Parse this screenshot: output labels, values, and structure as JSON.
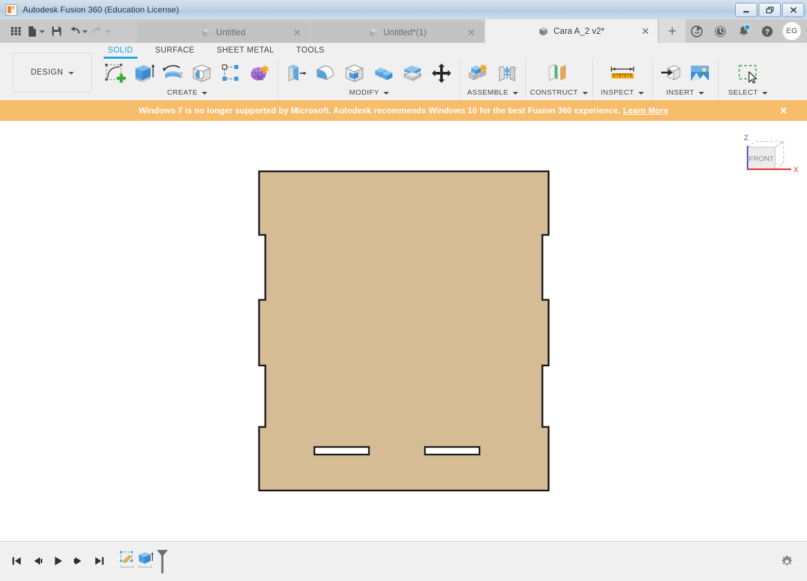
{
  "window": {
    "title": "Autodesk Fusion 360 (Education License)",
    "app_icon": "fusion360-logo-icon",
    "controls": {
      "minimize": "minimize-icon",
      "restore": "restore-icon",
      "close": "close-icon"
    }
  },
  "quick_access": [
    {
      "name": "apps-grid-icon",
      "label": "",
      "has_caret": false,
      "dim": false
    },
    {
      "name": "new-file-icon",
      "label": "",
      "has_caret": true,
      "dim": false
    },
    {
      "name": "save-icon",
      "label": "",
      "has_caret": false,
      "dim": false
    },
    {
      "name": "undo-icon",
      "label": "",
      "has_caret": true,
      "dim": false
    },
    {
      "name": "redo-icon",
      "label": "",
      "has_caret": true,
      "dim": true
    }
  ],
  "document_tabs": [
    {
      "label": "Untitled",
      "active": false
    },
    {
      "label": "Untitled*(1)",
      "active": false
    },
    {
      "label": "Cara A_2 v2*",
      "active": true
    }
  ],
  "new_tab_label": "+",
  "top_right_icons": [
    {
      "name": "job-status-icon",
      "badge": false
    },
    {
      "name": "recent-activity-clock-icon",
      "badge": false
    },
    {
      "name": "notifications-bell-icon",
      "badge": true
    },
    {
      "name": "help-icon",
      "badge": false
    }
  ],
  "account": {
    "initials": "EG"
  },
  "ribbon": {
    "design_label": "DESIGN",
    "workspace_tabs": [
      {
        "label": "SOLID",
        "active": true
      },
      {
        "label": "SURFACE",
        "active": false
      },
      {
        "label": "SHEET METAL",
        "active": false
      },
      {
        "label": "TOOLS",
        "active": false
      }
    ],
    "panels": [
      {
        "label": "CREATE",
        "has_caret": true,
        "buttons": [
          {
            "name": "create-sketch-icon"
          },
          {
            "name": "extrude-icon"
          },
          {
            "name": "revolve-icon"
          },
          {
            "name": "hole-icon"
          },
          {
            "name": "rectangular-pattern-icon"
          },
          {
            "name": "create-form-icon"
          }
        ]
      },
      {
        "label": "MODIFY",
        "has_caret": true,
        "buttons": [
          {
            "name": "press-pull-icon"
          },
          {
            "name": "fillet-icon"
          },
          {
            "name": "shell-icon"
          },
          {
            "name": "combine-icon"
          },
          {
            "name": "split-face-icon"
          },
          {
            "name": "move-copy-icon"
          }
        ]
      },
      {
        "label": "ASSEMBLE",
        "has_caret": true,
        "buttons": [
          {
            "name": "new-component-icon"
          },
          {
            "name": "joint-icon"
          }
        ]
      },
      {
        "label": "CONSTRUCT",
        "has_caret": true,
        "buttons": [
          {
            "name": "offset-plane-icon"
          }
        ]
      },
      {
        "label": "INSPECT",
        "has_caret": true,
        "buttons": [
          {
            "name": "measure-icon"
          }
        ]
      },
      {
        "label": "INSERT",
        "has_caret": true,
        "buttons": [
          {
            "name": "insert-derive-icon"
          },
          {
            "name": "insert-image-icon"
          }
        ]
      },
      {
        "label": "SELECT",
        "has_caret": true,
        "buttons": [
          {
            "name": "select-window-icon"
          }
        ]
      }
    ]
  },
  "banner": {
    "message": "Windows 7 is no longer supported by Microsoft. Autodesk recommends Windows 10 for the best Fusion 360 experience.",
    "link_label": "Learn More",
    "close_label": "✕",
    "background_color": "#f7bd6b",
    "text_color": "#ffffff"
  },
  "canvas": {
    "background_color": "#ffffff",
    "model": {
      "name": "notched-panel-body",
      "fill_color": "#d6bc94",
      "edge_color": "#1a1a1a",
      "slot_fill_color": "#ffffff",
      "slots": 2,
      "side_notches_per_side": 3
    },
    "viewcube": {
      "face_label": "FRONT",
      "axis_z_label": "Z",
      "axis_x_label": "X",
      "axis_z_color": "#5b57d6",
      "axis_x_color": "#e03434"
    }
  },
  "bottom_bar": {
    "timeline_buttons": [
      {
        "name": "timeline-jump-start-button"
      },
      {
        "name": "timeline-step-back-button"
      },
      {
        "name": "timeline-play-button"
      },
      {
        "name": "timeline-step-forward-button"
      },
      {
        "name": "timeline-jump-end-button"
      }
    ],
    "timeline_features": [
      {
        "name": "timeline-feature-sketch-icon"
      },
      {
        "name": "timeline-feature-extrude-icon"
      }
    ],
    "settings_icon": "settings-gear-icon"
  }
}
